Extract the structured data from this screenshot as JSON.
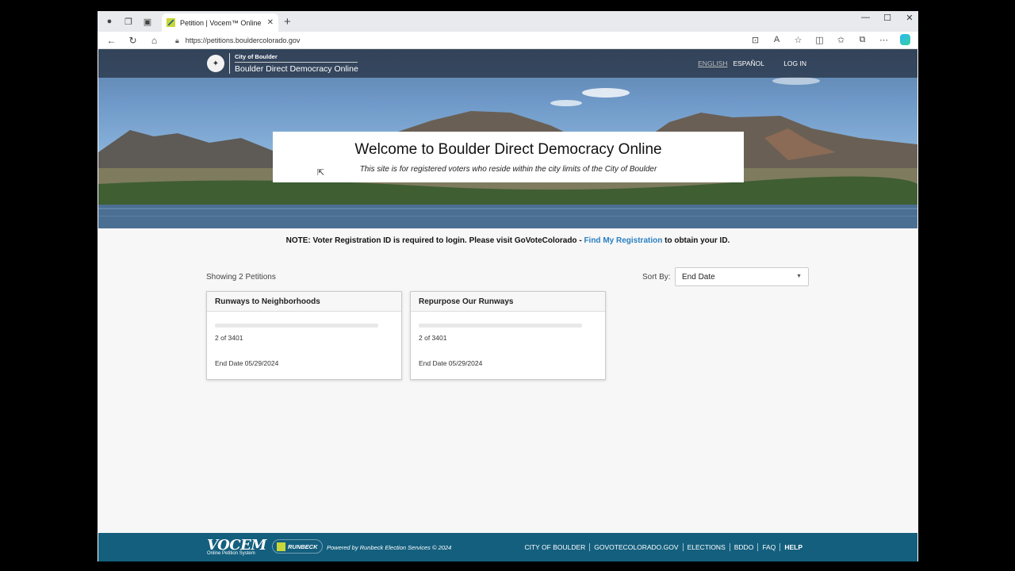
{
  "browser": {
    "tab_title": "Petition | Vocem™ Online",
    "url": "https://petitions.bouldercolorado.gov"
  },
  "header": {
    "city": "City of Boulder",
    "site_name": "Boulder Direct Democracy Online",
    "lang_english": "ENGLISH",
    "lang_espanol": "ESPAÑOL",
    "login": "LOG IN"
  },
  "hero": {
    "title": "Welcome to Boulder Direct Democracy Online",
    "subtitle": "This site is for registered voters who reside within the city limits of the City of Boulder"
  },
  "note": {
    "prefix": "NOTE: Voter Registration ID is required to login. Please visit GoVoteColorado - ",
    "link": "Find My Registration",
    "suffix": " to obtain your ID."
  },
  "listing": {
    "showing": "Showing 2 Petitions",
    "sort_label": "Sort By:",
    "sort_value": "End Date"
  },
  "petitions": [
    {
      "title": "Runways to Neighborhoods",
      "count": "2 of 3401",
      "progress": 0.0006,
      "end": "End Date 05/29/2024"
    },
    {
      "title": "Repurpose Our Runways",
      "count": "2 of 3401",
      "progress": 0.0006,
      "end": "End Date 05/29/2024"
    }
  ],
  "footer": {
    "vocem": "VOCEM",
    "vocem_sub": "Online Petition System",
    "runbeck": "RUNBECK",
    "powered": "Powered by Runbeck Election Services © 2024",
    "links": [
      "CITY OF BOULDER",
      "GOVOTECOLORADO.GOV",
      "ELECTIONS",
      "BDDO",
      "FAQ",
      "HELP"
    ]
  }
}
